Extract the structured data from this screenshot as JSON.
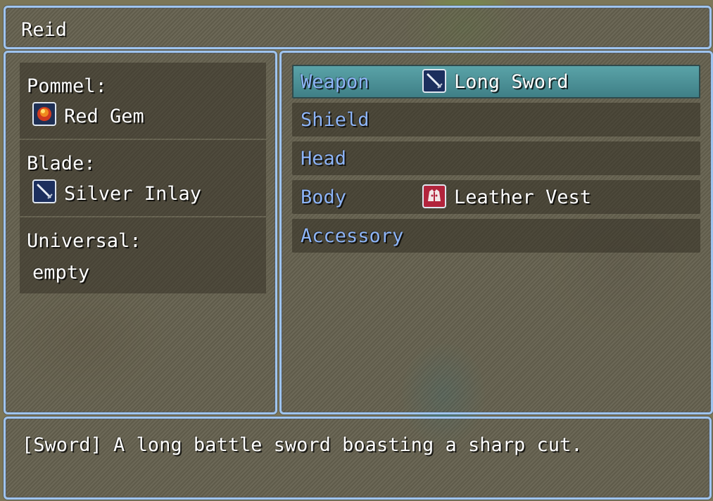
{
  "actor": {
    "name": "Reid"
  },
  "slots": [
    {
      "label": "Pommel:",
      "item": "Red Gem",
      "icon": "red-gem-icon"
    },
    {
      "label": "Blade:",
      "item": "Silver Inlay",
      "icon": "sword-icon"
    },
    {
      "label": "Universal:",
      "item": "empty",
      "icon": ""
    }
  ],
  "equipment": [
    {
      "slot": "Weapon",
      "item": "Long Sword",
      "icon": "sword-icon",
      "selected": true
    },
    {
      "slot": "Shield",
      "item": "",
      "icon": ""
    },
    {
      "slot": "Head",
      "item": "",
      "icon": ""
    },
    {
      "slot": "Body",
      "item": "Leather Vest",
      "icon": "vest-icon"
    },
    {
      "slot": "Accessory",
      "item": "",
      "icon": ""
    }
  ],
  "help": {
    "text": "[Sword] A long battle sword boasting a sharp cut."
  },
  "colors": {
    "system_text": "#8db4f6",
    "window_border": "#9fc4ee",
    "selection": "#4f949a"
  }
}
